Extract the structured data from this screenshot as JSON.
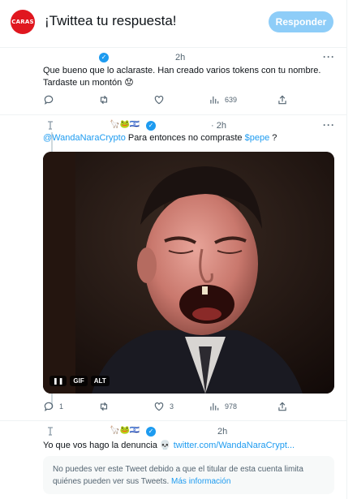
{
  "header": {
    "logo_text": "CARAS",
    "title": "¡Twittea tu respuesta!",
    "reply_button": "Responder"
  },
  "tweet1": {
    "time": "2h",
    "text_line1": "Que bueno que lo aclaraste. Han creado varios tokens con tu nombre.",
    "text_line2": "Tardaste un montón 😟",
    "views": "639"
  },
  "tweet2": {
    "emojis": "🦙🐸🇮🇱",
    "time": "· 2h",
    "mention": "@WandaNaraCrypto",
    "text": " Para entonces no compraste ",
    "cashtag": "$pepe",
    "text_end": " ?",
    "media_badges": [
      "GIF",
      "ALT"
    ],
    "replies": "1",
    "likes": "3",
    "views": "978"
  },
  "tweet3": {
    "emojis": "🦙🐸🇮🇱",
    "time": "2h",
    "text": "Yo que vos hago la denuncia 💀",
    "link": "twitter.com/WandaNaraCrypt...",
    "notice_text": "No puedes ver este Tweet debido a que el titular de esta cuenta limita quiénes pueden ver sus Tweets.",
    "notice_link": "Más información"
  },
  "colors": {
    "accent": "#1d9bf0",
    "brand_red": "#e0171f",
    "reply_button_bg": "#8ecdf8",
    "muted_text": "#536471"
  },
  "icons": [
    "reply-icon",
    "retweet-icon",
    "like-icon",
    "views-icon",
    "share-icon",
    "verified-badge-icon",
    "more-options-icon",
    "pause-icon"
  ]
}
